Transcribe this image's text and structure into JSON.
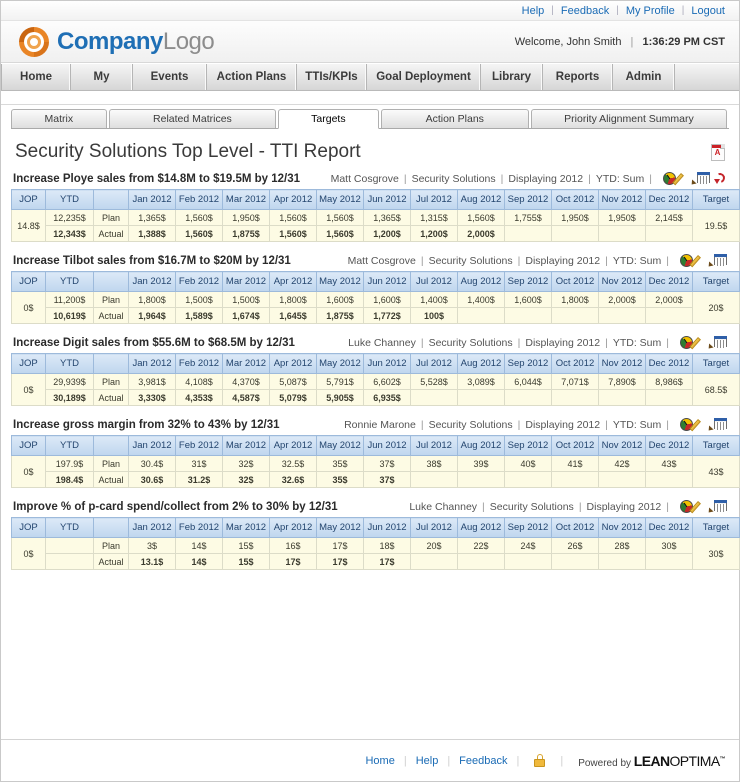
{
  "topbar": {
    "links": [
      "Help",
      "Feedback",
      "My Profile",
      "Logout"
    ],
    "separator": "|"
  },
  "header": {
    "brand_bold": "Company",
    "brand_light": "Logo",
    "welcome": "Welcome, John Smith",
    "separator": "|",
    "time": "1:36:29 PM CST"
  },
  "nav": {
    "items": [
      "Home",
      "My",
      "Events",
      "Action Plans",
      "TTIs/KPIs",
      "Goal Deployment",
      "Library",
      "Reports",
      "Admin"
    ]
  },
  "subtabs": {
    "items": [
      {
        "label": "Matrix",
        "active": false
      },
      {
        "label": "Related Matrices",
        "active": false
      },
      {
        "label": "Targets",
        "active": true
      },
      {
        "label": "Action Plans",
        "active": false
      },
      {
        "label": "Priority Alignment Summary",
        "active": false
      }
    ]
  },
  "page": {
    "title": "Security Solutions Top Level - TTI Report",
    "export_icon": "pdf-icon"
  },
  "table_columns": [
    "JOP",
    "YTD",
    "",
    "Jan 2012",
    "Feb 2012",
    "Mar 2012",
    "Apr 2012",
    "May 2012",
    "Jun 2012",
    "Jul 2012",
    "Aug 2012",
    "Sep 2012",
    "Oct 2012",
    "Nov 2012",
    "Dec 2012",
    "Target"
  ],
  "row_labels": {
    "plan": "Plan",
    "actual": "Actual"
  },
  "meta_separator": "|",
  "goals": [
    {
      "title": "Increase Ploye sales from $14.8M to $19.5M by 12/31",
      "owner": "Matt Cosgrove",
      "org": "Security Solutions",
      "displaying": "Displaying 2012",
      "ytd_mode": "YTD: Sum",
      "icons": [
        "gauge-icon",
        "pencil-icon",
        "grid-icon",
        "arrow-icon"
      ],
      "jop": "14.8$",
      "target": "19.5$",
      "ytd_plan": "12,235$",
      "ytd_actual": "12,343$",
      "ytd_actual_state": "green",
      "plan": [
        "1,365$",
        "1,560$",
        "1,950$",
        "1,560$",
        "1,560$",
        "1,365$",
        "1,315$",
        "1,560$",
        "1,755$",
        "1,950$",
        "1,950$",
        "2,145$"
      ],
      "actual": [
        "1,388$",
        "1,560$",
        "1,875$",
        "1,560$",
        "1,560$",
        "1,200$",
        "1,200$",
        "2,000$",
        "",
        "",
        "",
        ""
      ],
      "actual_state": [
        "green",
        "green",
        "red",
        "green",
        "green",
        "red",
        "red",
        "green",
        "",
        "",
        "",
        ""
      ]
    },
    {
      "title": "Increase Tilbot sales from $16.7M to $20M by 12/31",
      "owner": "Matt Cosgrove",
      "org": "Security Solutions",
      "displaying": "Displaying 2012",
      "ytd_mode": "YTD: Sum",
      "icons": [
        "gauge-icon",
        "pencil-icon",
        "grid-icon"
      ],
      "jop": "0$",
      "target": "20$",
      "ytd_plan": "11,200$",
      "ytd_actual": "10,619$",
      "ytd_actual_state": "red",
      "plan": [
        "1,800$",
        "1,500$",
        "1,500$",
        "1,800$",
        "1,600$",
        "1,600$",
        "1,400$",
        "1,400$",
        "1,600$",
        "1,800$",
        "2,000$",
        "2,000$"
      ],
      "actual": [
        "1,964$",
        "1,589$",
        "1,674$",
        "1,645$",
        "1,875$",
        "1,772$",
        "100$",
        "",
        "",
        "",
        "",
        ""
      ],
      "actual_state": [
        "green",
        "green",
        "green",
        "red",
        "green",
        "green",
        "red",
        "",
        "",
        "",
        "",
        ""
      ]
    },
    {
      "title": "Increase Digit sales from $55.6M to $68.5M by 12/31",
      "owner": "Luke Channey",
      "org": "Security Solutions",
      "displaying": "Displaying 2012",
      "ytd_mode": "YTD: Sum",
      "icons": [
        "gauge-icon",
        "pencil-icon",
        "grid-icon"
      ],
      "jop": "0$",
      "target": "68.5$",
      "ytd_plan": "29,939$",
      "ytd_actual": "30,189$",
      "ytd_actual_state": "green",
      "plan": [
        "3,981$",
        "4,108$",
        "4,370$",
        "5,087$",
        "5,791$",
        "6,602$",
        "5,528$",
        "3,089$",
        "6,044$",
        "7,071$",
        "7,890$",
        "8,986$"
      ],
      "actual": [
        "3,330$",
        "4,353$",
        "4,587$",
        "5,079$",
        "5,905$",
        "6,935$",
        "",
        "",
        "",
        "",
        "",
        ""
      ],
      "actual_state": [
        "red",
        "green",
        "green",
        "red",
        "green",
        "green",
        "",
        "",
        "",
        "",
        "",
        ""
      ]
    },
    {
      "title": "Increase gross margin from 32% to 43% by 12/31",
      "owner": "Ronnie Marone",
      "org": "Security Solutions",
      "displaying": "Displaying 2012",
      "ytd_mode": "YTD: Sum",
      "icons": [
        "gauge-icon",
        "pencil-icon",
        "grid-icon"
      ],
      "jop": "0$",
      "target": "43$",
      "ytd_plan": "197.9$",
      "ytd_actual": "198.4$",
      "ytd_actual_state": "green",
      "plan": [
        "30.4$",
        "31$",
        "32$",
        "32.5$",
        "35$",
        "37$",
        "38$",
        "39$",
        "40$",
        "41$",
        "42$",
        "43$"
      ],
      "actual": [
        "30.6$",
        "31.2$",
        "32$",
        "32.6$",
        "35$",
        "37$",
        "",
        "",
        "",
        "",
        "",
        ""
      ],
      "actual_state": [
        "green",
        "green",
        "green",
        "green",
        "green",
        "green",
        "",
        "",
        "",
        "",
        "",
        ""
      ]
    },
    {
      "title": "Improve % of p-card spend/collect from 2% to 30% by 12/31",
      "owner": "Luke Channey",
      "org": "Security Solutions",
      "displaying": "Displaying 2012",
      "ytd_mode": "",
      "icons": [
        "gauge-icon",
        "pencil-icon",
        "grid-icon"
      ],
      "jop": "0$",
      "target": "30$",
      "ytd_plan": "",
      "ytd_actual": "",
      "ytd_actual_state": "",
      "plan": [
        "3$",
        "14$",
        "15$",
        "16$",
        "17$",
        "18$",
        "20$",
        "22$",
        "24$",
        "26$",
        "28$",
        "30$"
      ],
      "actual": [
        "13.1$",
        "14$",
        "15$",
        "17$",
        "17$",
        "17$",
        "",
        "",
        "",
        "",
        "",
        ""
      ],
      "actual_state": [
        "green",
        "green",
        "green",
        "green",
        "green",
        "red",
        "",
        "",
        "",
        "",
        "",
        ""
      ]
    }
  ],
  "footer": {
    "links": [
      "Home",
      "Help",
      "Feedback"
    ],
    "lock_icon": "lock-icon",
    "powered_by": "Powered by",
    "logo_bold": "LEAN",
    "logo_thin": "OPTIMA",
    "logo_sup": "™"
  }
}
